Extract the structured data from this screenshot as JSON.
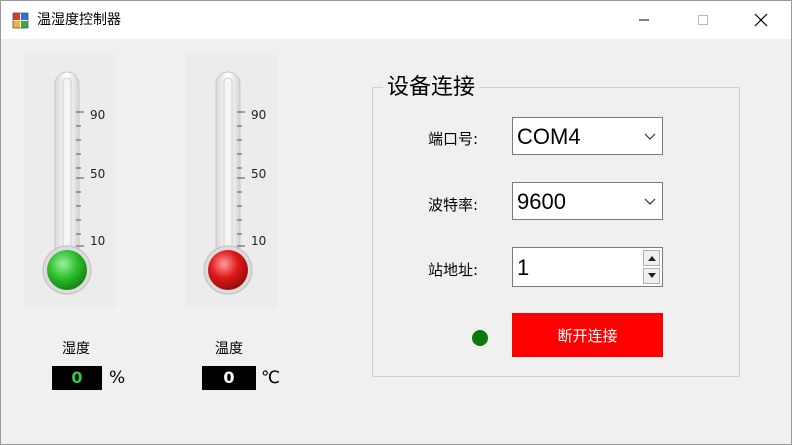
{
  "window": {
    "title": "温湿度控制器"
  },
  "gauges": {
    "ticks": [
      "90",
      "50",
      "10"
    ],
    "humidity": {
      "label": "湿度",
      "value": "0",
      "unit": "%",
      "bulb_color": "#2ec12e",
      "value_color": "#2ecc40"
    },
    "temperature": {
      "label": "温度",
      "value": "0",
      "unit": "℃",
      "bulb_color": "#e01818",
      "value_color": "#ffffff"
    }
  },
  "connection": {
    "group_title": "设备连接",
    "port_label": "端口号:",
    "port_value": "COM4",
    "baud_label": "波特率:",
    "baud_value": "9600",
    "address_label": "站地址:",
    "address_value": "1",
    "status_led_color": "#0a7a0a",
    "connect_button_label": "断开连接",
    "connect_button_color": "#ff0000"
  }
}
